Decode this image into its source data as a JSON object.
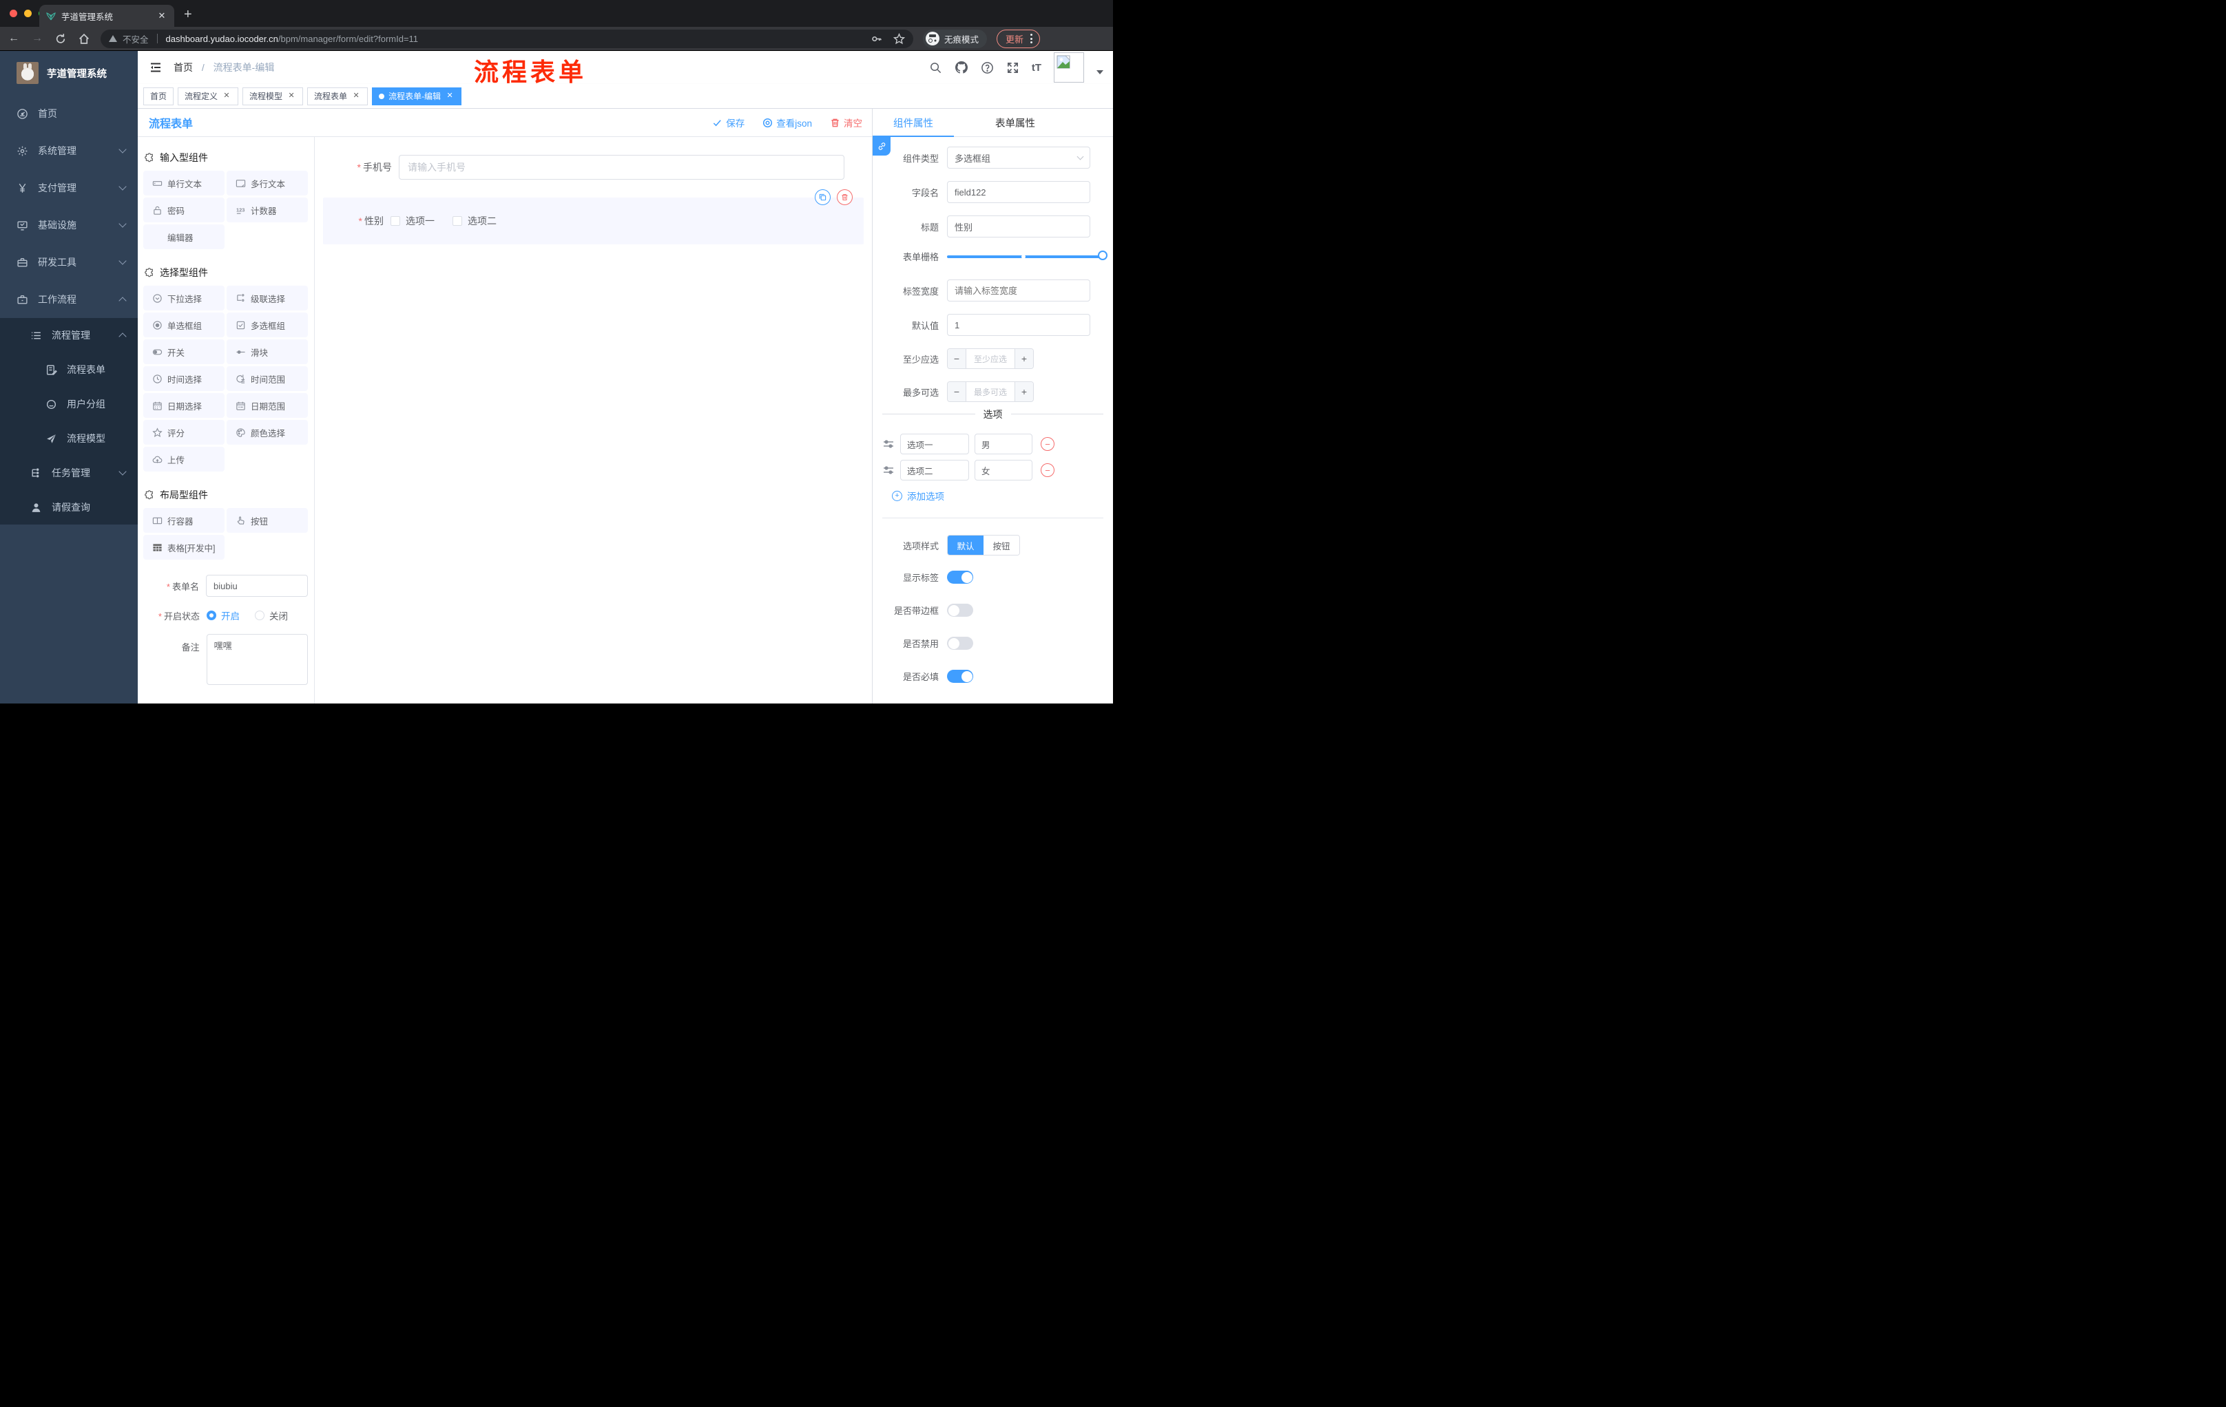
{
  "browser": {
    "tab_title": "芋道管理系统",
    "not_secure": "不安全",
    "url_domain": "dashboard.yudao.iocoder.cn",
    "url_path": "/bpm/manager/form/edit?formId=11",
    "incognito_label": "无痕模式",
    "update_label": "更新"
  },
  "navbar": {
    "breadcrumb_home": "首页",
    "breadcrumb_separator": "/",
    "breadcrumb_current": "流程表单-编辑",
    "font_size_label": "tT"
  },
  "annotation": {
    "text": "流程表单",
    "color": "#fd2b08"
  },
  "sidebar": {
    "title": "芋道管理系统",
    "menu": [
      {
        "label": "首页"
      },
      {
        "label": "系统管理"
      },
      {
        "label": "支付管理"
      },
      {
        "label": "基础设施"
      },
      {
        "label": "研发工具"
      },
      {
        "label": "工作流程"
      }
    ],
    "sub": [
      {
        "label": "流程管理"
      },
      {
        "label": "流程表单"
      },
      {
        "label": "用户分组"
      },
      {
        "label": "流程模型"
      },
      {
        "label": "任务管理"
      },
      {
        "label": "请假查询"
      }
    ]
  },
  "tags": [
    {
      "label": "首页"
    },
    {
      "label": "流程定义"
    },
    {
      "label": "流程模型"
    },
    {
      "label": "流程表单"
    },
    {
      "label": "流程表单-编辑"
    }
  ],
  "designer": {
    "title": "流程表单",
    "save_label": "保存",
    "view_json_label": "查看json",
    "clear_label": "清空"
  },
  "components": {
    "input_section": "输入型组件",
    "input_items": [
      "单行文本",
      "多行文本",
      "密码",
      "计数器",
      "编辑器"
    ],
    "select_section": "选择型组件",
    "select_items": [
      "下拉选择",
      "级联选择",
      "单选框组",
      "多选框组",
      "开关",
      "滑块",
      "时间选择",
      "时间范围",
      "日期选择",
      "日期范围",
      "评分",
      "颜色选择",
      "上传"
    ],
    "layout_section": "布局型组件",
    "layout_items": [
      "行容器",
      "按钮",
      "表格[开发中]"
    ],
    "form": {
      "name_label": "表单名",
      "name_value": "biubiu",
      "status_label": "开启状态",
      "status_on": "开启",
      "status_off": "关闭",
      "remark_label": "备注",
      "remark_value": "嘿嘿"
    }
  },
  "canvas": {
    "phone_label": "手机号",
    "phone_placeholder": "请输入手机号",
    "gender_label": "性别",
    "gender_option1": "选项一",
    "gender_option2": "选项二"
  },
  "props": {
    "tab_component": "组件属性",
    "tab_form": "表单属性",
    "component_type_label": "组件类型",
    "component_type_value": "多选框组",
    "field_name_label": "字段名",
    "field_name_value": "field122",
    "title_label": "标题",
    "title_value": "性别",
    "grid_label": "表单栅格",
    "label_width_label": "标签宽度",
    "label_width_placeholder": "请输入标签宽度",
    "default_label": "默认值",
    "default_value": "1",
    "min_label": "至少应选",
    "min_placeholder": "至少应选",
    "max_label": "最多可选",
    "max_placeholder": "最多可选",
    "options_title": "选项",
    "options": [
      {
        "text": "选项一",
        "value": "男"
      },
      {
        "text": "选项二",
        "value": "女"
      }
    ],
    "add_option_label": "添加选项",
    "style_label": "选项样式",
    "style_default": "默认",
    "style_button": "按钮",
    "show_label_label": "显示标签",
    "border_label": "是否带边框",
    "disabled_label": "是否禁用",
    "required_label": "是否必填",
    "accent_color": "#409eff",
    "danger_color": "#f56c6c"
  }
}
